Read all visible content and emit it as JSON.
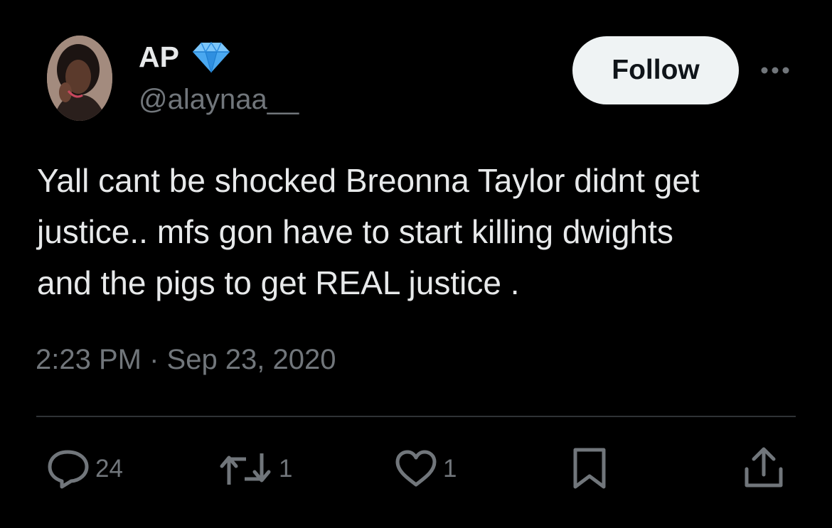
{
  "author": {
    "display_name": "AP",
    "handle": "@alaynaa__",
    "badge_icon": "gem-icon",
    "avatar_alt": "profile photo"
  },
  "follow_button": {
    "label": "Follow"
  },
  "more_button": {
    "icon": "more-horizontal-icon"
  },
  "tweet": {
    "lines": [
      "Yall cant be shocked Breonna Taylor didnt get",
      "justice.. mfs gon have to start killing dwights",
      "and the pigs to get REAL justice ."
    ],
    "timestamp": "2:23 PM · Sep 23, 2020"
  },
  "actions": {
    "reply": {
      "icon": "reply-icon",
      "count": "24"
    },
    "retweet": {
      "icon": "retweet-icon",
      "count": "1"
    },
    "like": {
      "icon": "heart-icon",
      "count": "1"
    },
    "bookmark": {
      "icon": "bookmark-icon"
    },
    "share": {
      "icon": "share-icon"
    }
  },
  "colors": {
    "background": "#000000",
    "text_primary": "#e7e9ea",
    "text_secondary": "#71767b",
    "follow_bg": "#eff3f4",
    "divider": "#2f3336",
    "badge_blue": "#4aa8f0"
  }
}
